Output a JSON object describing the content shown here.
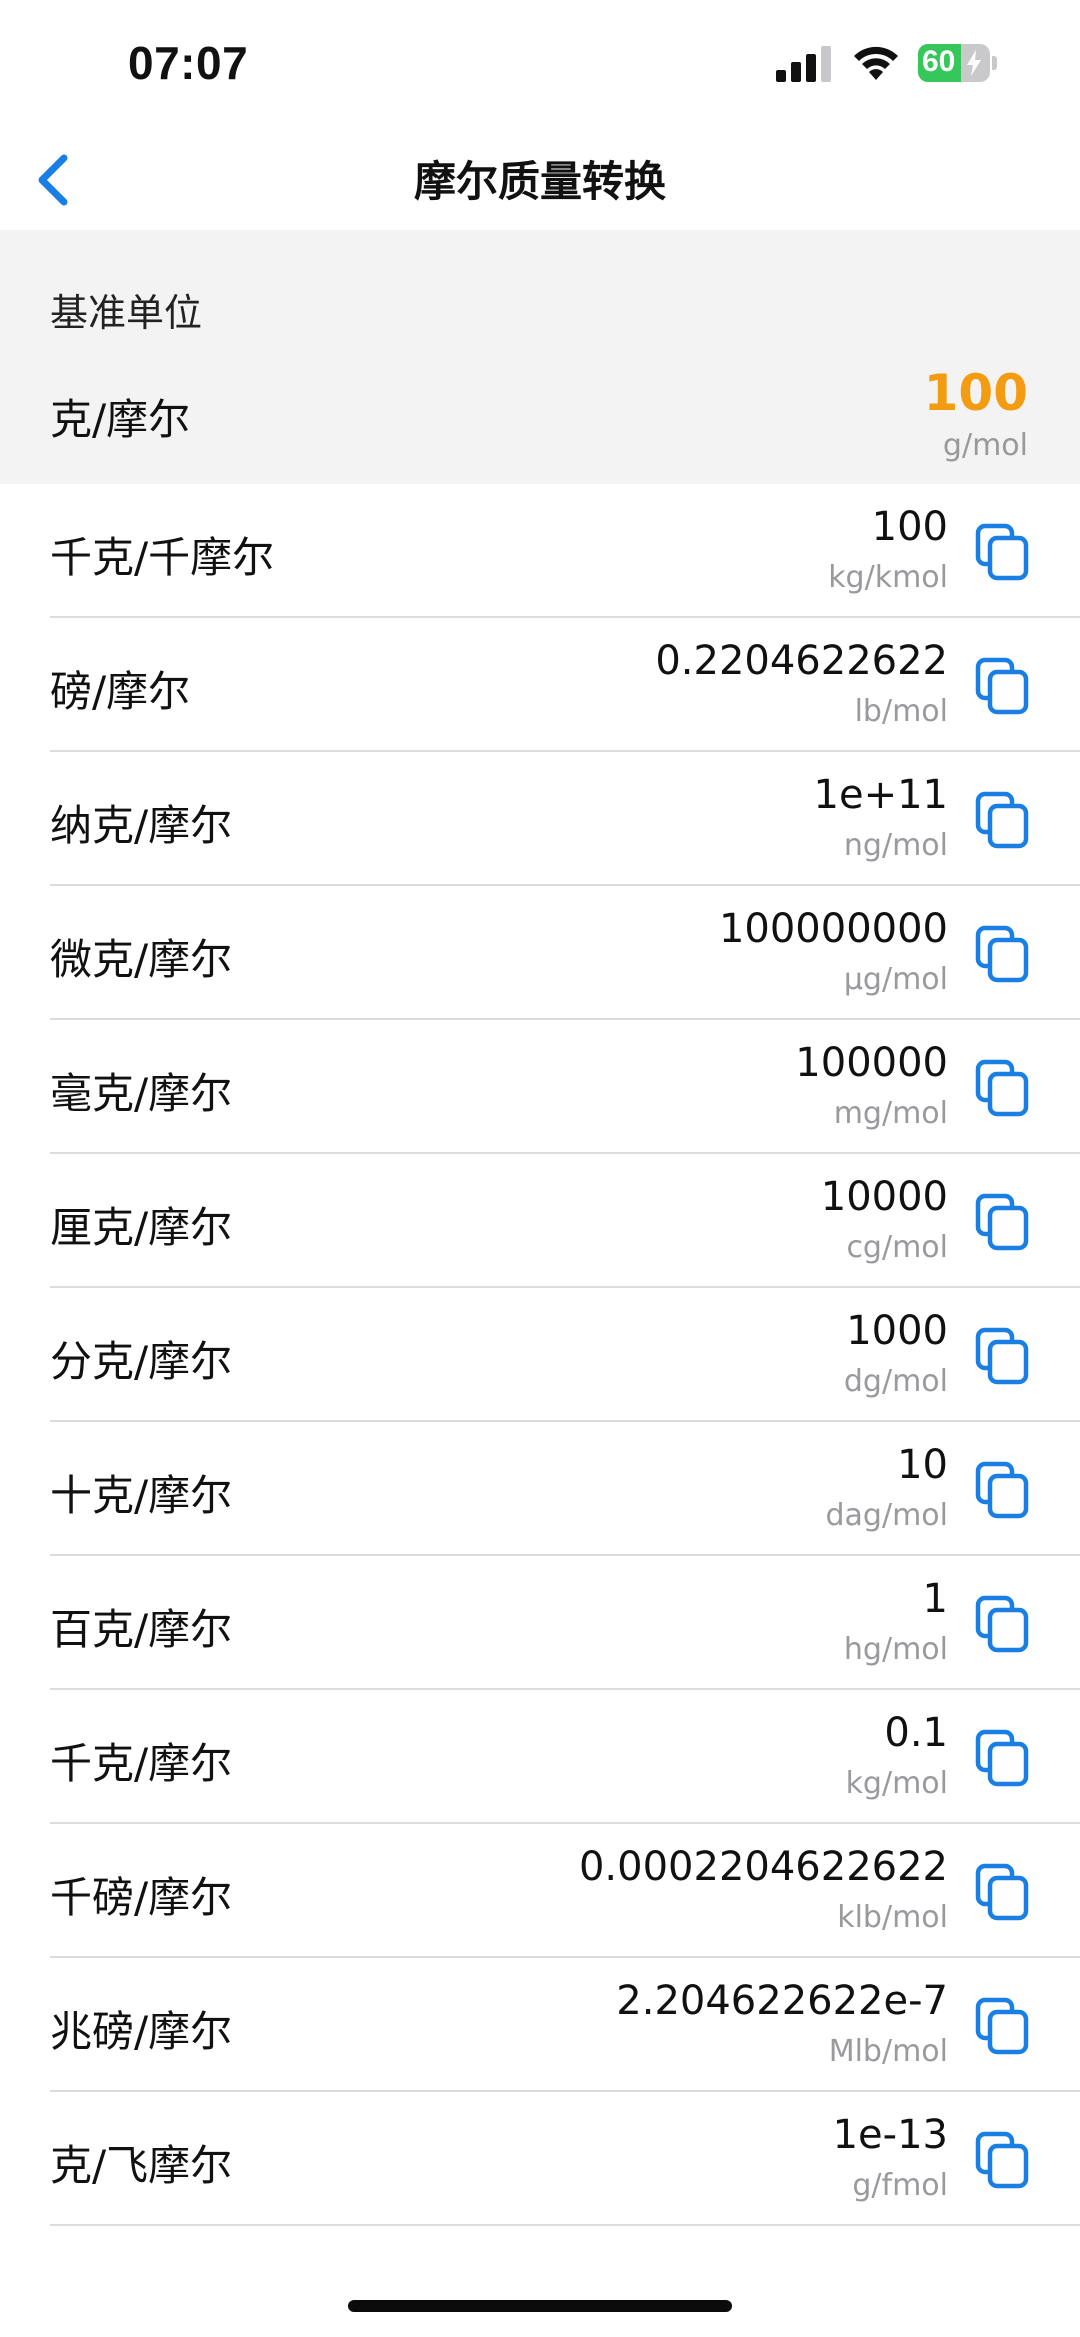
{
  "status_bar": {
    "time": "07:07",
    "battery_level": "60",
    "battery_fraction": 0.6,
    "icons": [
      "signal-icon",
      "wifi-icon",
      "battery-icon"
    ]
  },
  "nav": {
    "back_icon": "chevron-left-icon",
    "title": "摩尔质量转换"
  },
  "base": {
    "caption": "基准单位",
    "unit_name": "克/摩尔",
    "value": "100",
    "symbol": "g/mol"
  },
  "colors": {
    "accent_blue": "#1a7fe5",
    "accent_orange": "#f39c12",
    "battery_green": "#35c759"
  },
  "units": [
    {
      "name": "千克/千摩尔",
      "value": "100",
      "symbol": "kg/kmol"
    },
    {
      "name": "磅/摩尔",
      "value": "0.2204622622",
      "symbol": "lb/mol"
    },
    {
      "name": "纳克/摩尔",
      "value": "1e+11",
      "symbol": "ng/mol"
    },
    {
      "name": "微克/摩尔",
      "value": "100000000",
      "symbol": "µg/mol"
    },
    {
      "name": "毫克/摩尔",
      "value": "100000",
      "symbol": "mg/mol"
    },
    {
      "name": "厘克/摩尔",
      "value": "10000",
      "symbol": "cg/mol"
    },
    {
      "name": "分克/摩尔",
      "value": "1000",
      "symbol": "dg/mol"
    },
    {
      "name": "十克/摩尔",
      "value": "10",
      "symbol": "dag/mol"
    },
    {
      "name": "百克/摩尔",
      "value": "1",
      "symbol": "hg/mol"
    },
    {
      "name": "千克/摩尔",
      "value": "0.1",
      "symbol": "kg/mol"
    },
    {
      "name": "千磅/摩尔",
      "value": "0.0002204622622",
      "symbol": "klb/mol"
    },
    {
      "name": "兆磅/摩尔",
      "value": "2.204622622e-7",
      "symbol": "Mlb/mol"
    },
    {
      "name": "克/飞摩尔",
      "value": "1e-13",
      "symbol": "g/fmol"
    }
  ]
}
